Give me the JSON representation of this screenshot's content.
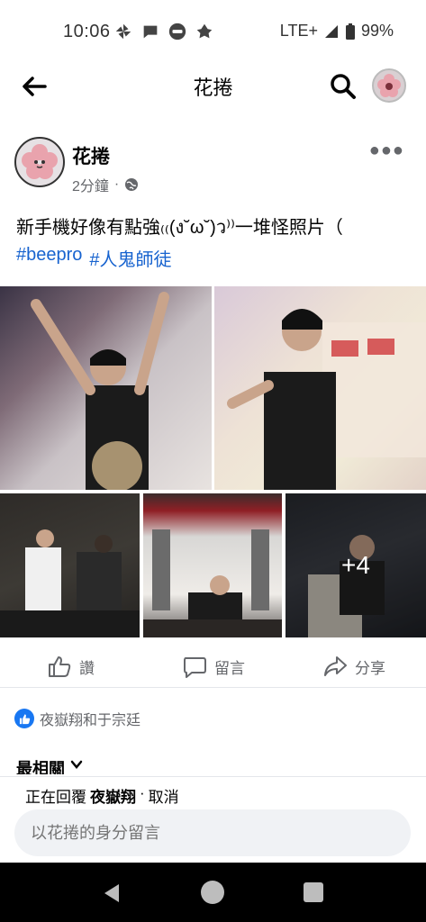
{
  "status_bar": {
    "time": "10:06",
    "network": "LTE+",
    "battery": "99%",
    "left_icons": [
      "pinwheel-icon",
      "chat-bubble-icon",
      "line-app-icon",
      "leaf-icon"
    ]
  },
  "app_bar": {
    "title": "花捲"
  },
  "post": {
    "author": "花捲",
    "time": "2分鐘",
    "meta_separator": "·",
    "text": "新手機好像有點強₍₍(ง˘ω˘)ว⁾⁾一堆怪照片（",
    "hashtags": [
      "#beepro",
      "#人鬼師徒"
    ],
    "more_photos_label": "+4"
  },
  "actions": {
    "like": "讚",
    "comment": "留言",
    "share": "分享"
  },
  "reactions": {
    "text": "夜嶽翔和于宗廷"
  },
  "comments": {
    "sort_label": "最相關"
  },
  "reply": {
    "prefix": "正在回覆",
    "name": "夜嶽翔",
    "separator": "·",
    "cancel": "取消",
    "placeholder": "以花捲的身分留言"
  },
  "colors": {
    "link": "#1763cf",
    "like_blue": "#1877f2",
    "secondary_text": "#65676b"
  }
}
